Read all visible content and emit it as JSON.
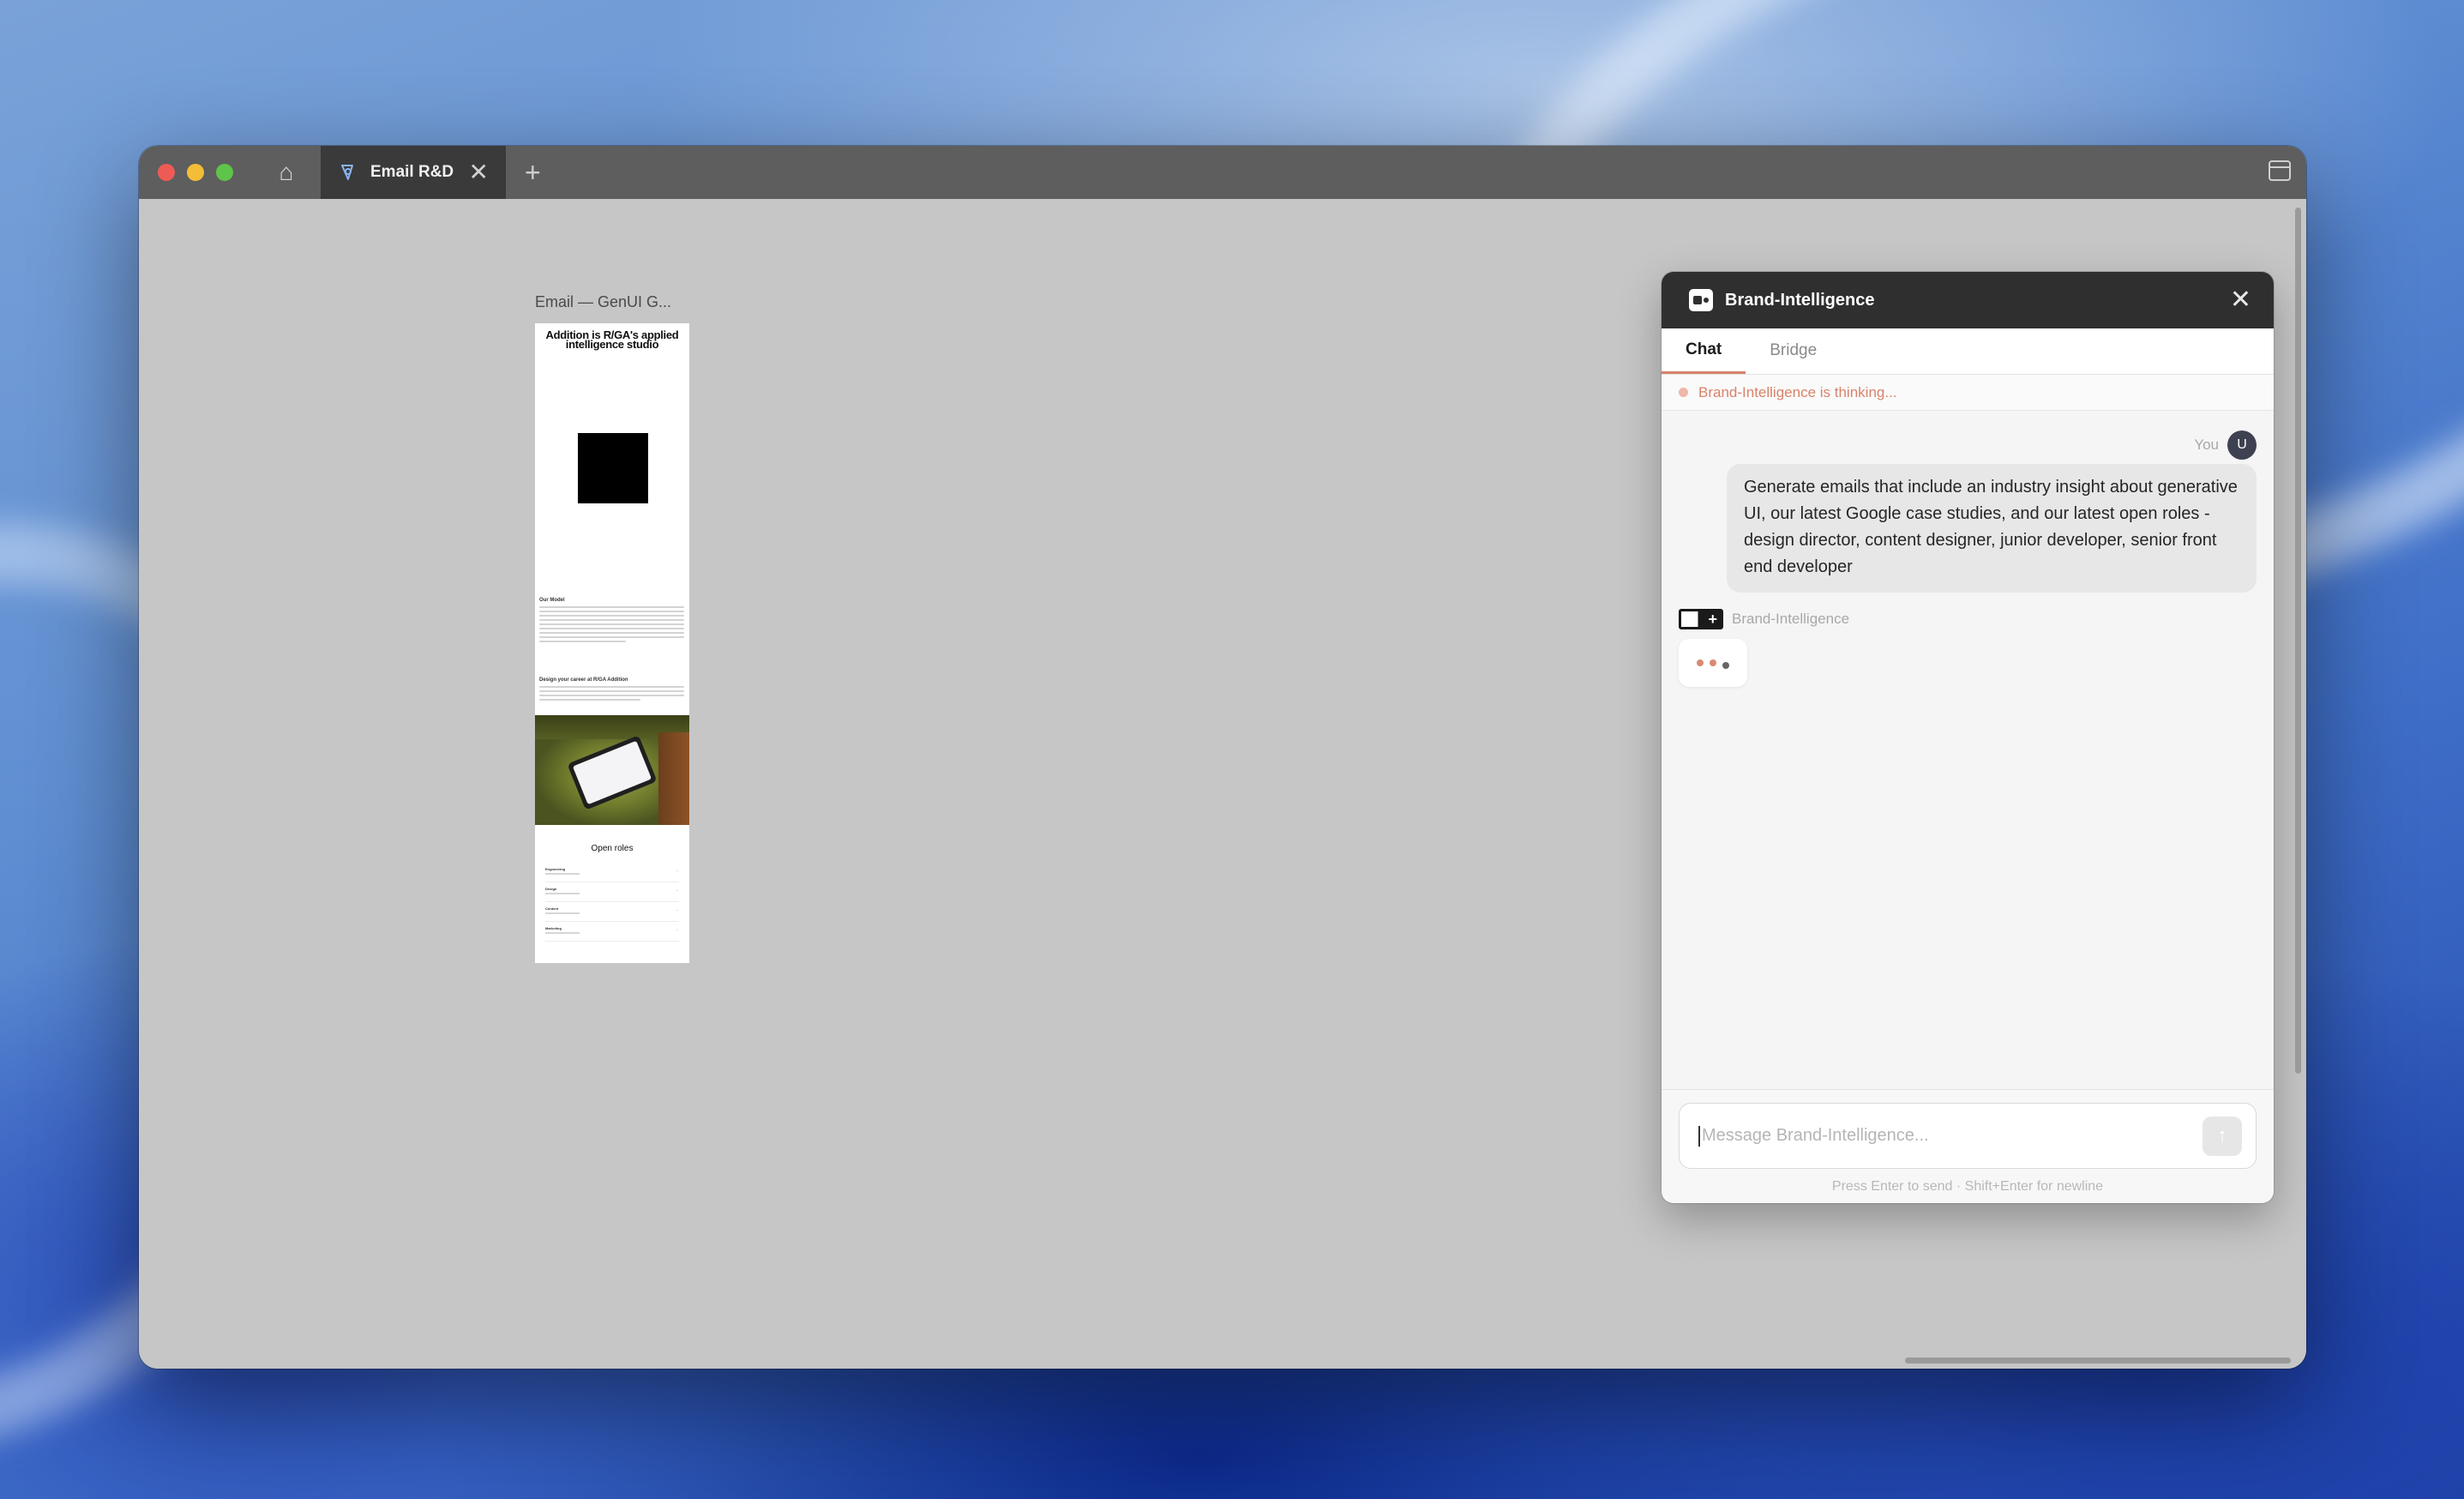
{
  "browser": {
    "tab_title": "Email R&D",
    "tab_close": "✕",
    "new_tab": "+",
    "home_icon": "⌂"
  },
  "email_frame": {
    "label": "Email — GenUI G...",
    "hero_title": "Addition is R/GA's applied intelligence studio",
    "section_heading": "Our Model",
    "section2_heading": "Design your career at R/GA Addition",
    "roles_title": "Open roles",
    "roles": [
      {
        "title": "Engineering"
      },
      {
        "title": "Design"
      },
      {
        "title": "Content"
      },
      {
        "title": "Marketing"
      }
    ],
    "arrow": "→"
  },
  "chat": {
    "title": "Brand-Intelligence",
    "close": "✕",
    "tabs": [
      {
        "label": "Chat",
        "active": true
      },
      {
        "label": "Bridge",
        "active": false
      }
    ],
    "status": "Brand-Intelligence is thinking...",
    "user_label": "You",
    "user_avatar": "U",
    "user_message": "Generate emails that include an industry insight about generative UI, our latest Google case studies, and our latest open roles - design director, content designer, junior developer, senior front end developer",
    "assistant_label": "Brand-Intelligence",
    "assistant_logo_glyph": "+",
    "input_placeholder": "Message Brand-Intelligence...",
    "send_icon": "↑",
    "hint": "Press Enter to send · Shift+Enter for newline"
  },
  "colors": {
    "accent": "#d6826a",
    "titlebar": "#5e5e5e",
    "panel_header": "#2f2f2f",
    "canvas": "#c6c6c6"
  }
}
